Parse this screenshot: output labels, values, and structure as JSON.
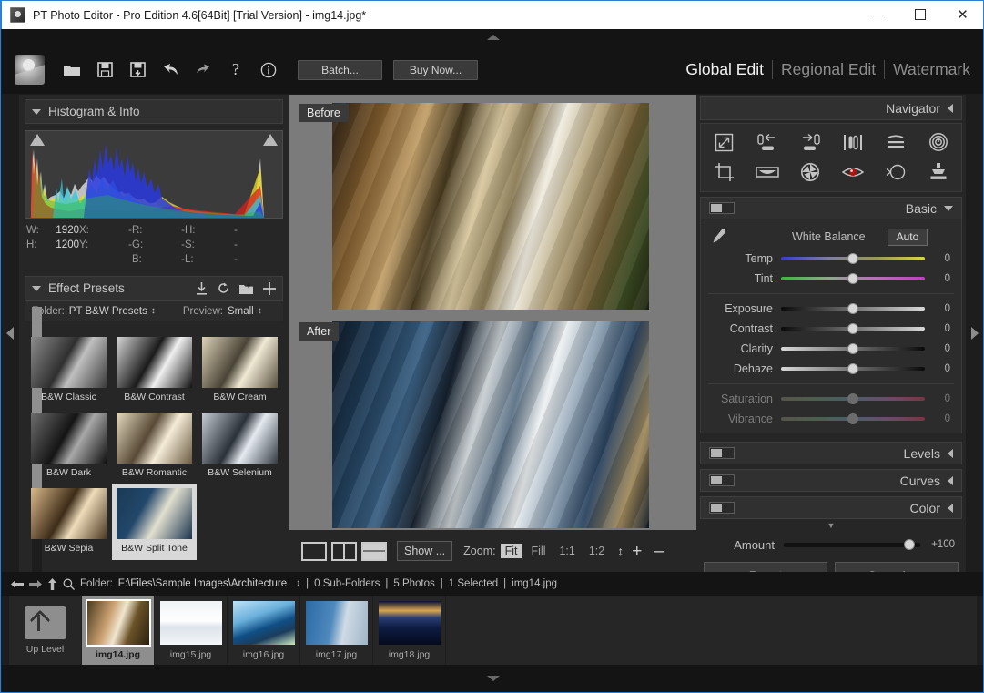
{
  "window": {
    "title": "PT Photo Editor - Pro Edition 4.6[64Bit] [Trial Version] - img14.jpg*",
    "app_icon": "app-logo-icon",
    "minimize": "minimize-icon",
    "maximize": "maximize-icon",
    "close": "close-icon"
  },
  "toolbar": {
    "icons": [
      "open-folder-icon",
      "save-icon",
      "save-as-icon",
      "undo-icon",
      "redo-icon",
      "help-icon",
      "info-icon"
    ],
    "batch_label": "Batch...",
    "buy_label": "Buy Now...",
    "modes": [
      {
        "label": "Global Edit",
        "active": true
      },
      {
        "label": "Regional Edit",
        "active": false
      },
      {
        "label": "Watermark",
        "active": false
      }
    ]
  },
  "left_panel": {
    "histogram": {
      "title": "Histogram & Info",
      "collapse_icon": "caret-down-icon",
      "info": {
        "w_label": "W:",
        "w_value": "1920",
        "h_label": "H:",
        "h_value": "1200",
        "x_label": "X:",
        "x_value": "-",
        "y_label": "Y:",
        "y_value": "-",
        "r_label": "R:",
        "r_value": "-",
        "g_label": "G:",
        "g_value": "-",
        "b_label": "B:",
        "b_value": "-",
        "hh_label": "H:",
        "hh_value": "-",
        "s_label": "S:",
        "s_value": "-",
        "l_label": "L:",
        "l_value": "-"
      }
    },
    "presets": {
      "title": "Effect Presets",
      "header_icons": [
        "download-icon",
        "refresh-icon",
        "new-folder-icon",
        "add-icon"
      ],
      "folder_label": "Folder:",
      "folder_value": "PT B&W Presets",
      "preview_label": "Preview:",
      "preview_value": "Small",
      "items": [
        {
          "label": "B&W Classic",
          "selected": false,
          "c1": "#8c8c8c",
          "c2": "#2f2f2f"
        },
        {
          "label": "B&W Contrast",
          "selected": false,
          "c1": "#d8d8d8",
          "c2": "#1a1a1a"
        },
        {
          "label": "B&W Cream",
          "selected": false,
          "c1": "#ded3b8",
          "c2": "#4a4437"
        },
        {
          "label": "B&W Dark",
          "selected": false,
          "c1": "#6d6d6d",
          "c2": "#141414"
        },
        {
          "label": "B&W Romantic",
          "selected": false,
          "c1": "#e7dbc2",
          "c2": "#584a36"
        },
        {
          "label": "B&W Selenium",
          "selected": false,
          "c1": "#c6cdd4",
          "c2": "#2b3138"
        },
        {
          "label": "B&W Sepia",
          "selected": false,
          "c1": "#d9b98a",
          "c2": "#3e2c18"
        },
        {
          "label": "B&W Split Tone",
          "selected": true,
          "c1": "#cdd3c6",
          "c2": "#1b3a55"
        }
      ]
    }
  },
  "center": {
    "before_label": "Before",
    "after_label": "After",
    "layout_buttons": [
      "single-view-icon",
      "side-by-side-icon",
      "top-bottom-icon"
    ],
    "show_label": "Show ...",
    "zoom_label": "Zoom:",
    "zoom_options": [
      {
        "label": "Fit",
        "selected": true
      },
      {
        "label": "Fill",
        "selected": false
      },
      {
        "label": "1:1",
        "selected": false
      },
      {
        "label": "1:2",
        "selected": false
      }
    ],
    "zoom_in": "+",
    "zoom_out": "–"
  },
  "right_panel": {
    "navigator": {
      "title": "Navigator",
      "collapse_icon": "caret-left-icon"
    },
    "tools": [
      "resize-icon",
      "rotate-left-icon",
      "rotate-right-icon",
      "flip-icon",
      "straighten-icon",
      "distort-icon",
      "crop-icon",
      "perspective-icon",
      "lens-correction-icon",
      "red-eye-icon",
      "spot-removal-icon",
      "clone-stamp-icon"
    ],
    "basic": {
      "title": "Basic",
      "expanded": true,
      "collapse_icon": "caret-down-icon",
      "eyedropper_icon": "eyedropper-icon",
      "white_balance_label": "White Balance",
      "auto_label": "Auto",
      "sliders": [
        {
          "name": "Temp",
          "value": "0",
          "pos": 50,
          "disabled": false,
          "track": "wb-temp"
        },
        {
          "name": "Tint",
          "value": "0",
          "pos": 50,
          "disabled": false,
          "track": "wb-tint"
        },
        {
          "name": "Exposure",
          "value": "0",
          "pos": 50,
          "disabled": false,
          "track": "dark-light"
        },
        {
          "name": "Contrast",
          "value": "0",
          "pos": 50,
          "disabled": false,
          "track": "dark-light"
        },
        {
          "name": "Clarity",
          "value": "0",
          "pos": 50,
          "disabled": false,
          "track": "light-dark"
        },
        {
          "name": "Dehaze",
          "value": "0",
          "pos": 50,
          "disabled": false,
          "track": "light-dark"
        },
        {
          "name": "Saturation",
          "value": "0",
          "pos": 50,
          "disabled": true,
          "track": "sat"
        },
        {
          "name": "Vibrance",
          "value": "0",
          "pos": 50,
          "disabled": true,
          "track": "sat"
        }
      ]
    },
    "sections": [
      {
        "title": "Levels",
        "collapse_icon": "caret-left-icon"
      },
      {
        "title": "Curves",
        "collapse_icon": "caret-left-icon"
      },
      {
        "title": "Color",
        "collapse_icon": "caret-left-icon"
      }
    ],
    "amount": {
      "label": "Amount",
      "value": "+100",
      "pos": 92
    },
    "reset_label": "Reset",
    "save_as_label": "Save As..."
  },
  "status_bar": {
    "icons": [
      "back-arrow-icon",
      "forward-arrow-icon",
      "up-arrow-icon",
      "search-icon"
    ],
    "folder_label": "Folder:",
    "folder_path": "F:\\Files\\Sample Images\\Architecture",
    "sub_folders": "0 Sub-Folders",
    "photos": "5 Photos",
    "selected": "1 Selected",
    "current_file": "img14.jpg"
  },
  "filmstrip": {
    "up_level_label": "Up Level",
    "up_level_icon": "up-level-icon",
    "items": [
      {
        "label": "img14.jpg",
        "selected": true,
        "c1": "#caa071",
        "c2": "#3b2a14"
      },
      {
        "label": "img15.jpg",
        "selected": false,
        "c1": "#eef2f6",
        "c2": "#b9c4cf"
      },
      {
        "label": "img16.jpg",
        "selected": false,
        "c1": "#7fc1e8",
        "c2": "#0f4f86"
      },
      {
        "label": "img17.jpg",
        "selected": false,
        "c1": "#2b6aa5",
        "c2": "#cfdbe6"
      },
      {
        "label": "img18.jpg",
        "selected": false,
        "c1": "#0a1230",
        "c2": "#d9a451"
      }
    ]
  }
}
